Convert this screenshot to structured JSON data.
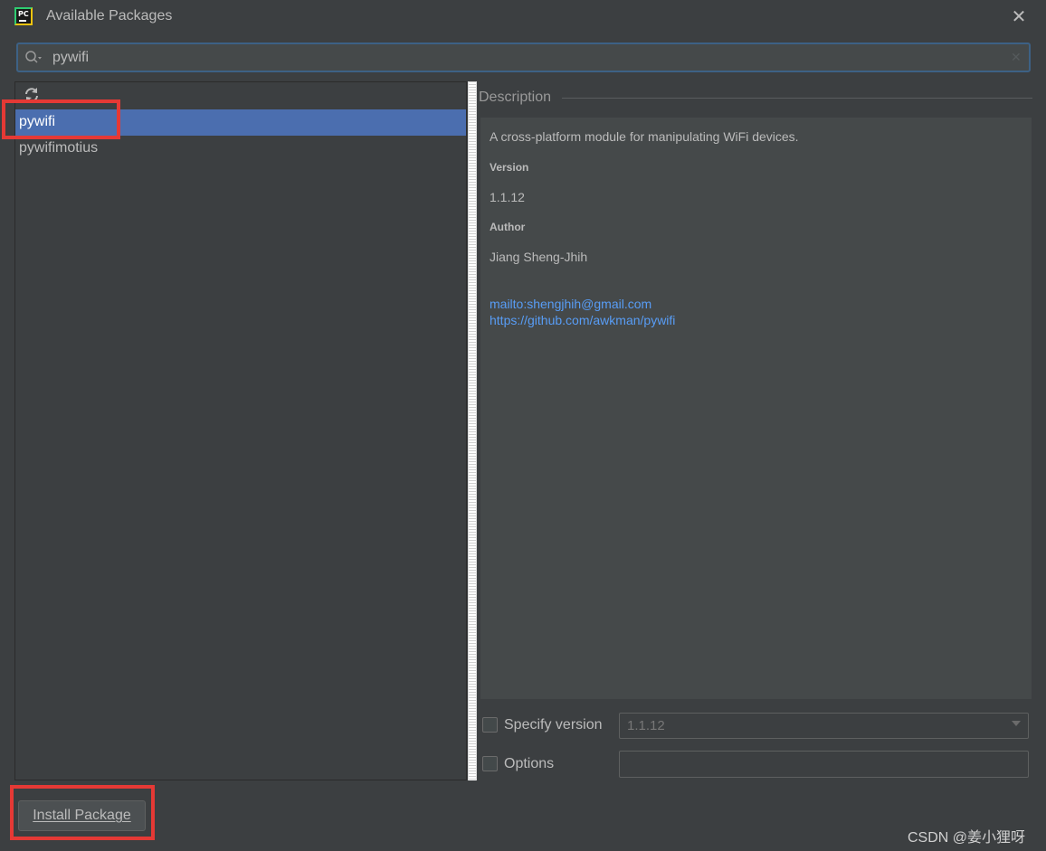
{
  "window": {
    "title": "Available Packages",
    "app_icon_text": "PC",
    "close_glyph": "✕"
  },
  "search": {
    "value": "pywifi"
  },
  "packages": [
    {
      "name": "pywifi",
      "selected": true
    },
    {
      "name": "pywifimotius",
      "selected": false
    }
  ],
  "description": {
    "header": "Description",
    "summary": "A cross-platform module for manipulating WiFi devices.",
    "version_label": "Version",
    "version": "1.1.12",
    "author_label": "Author",
    "author": "Jiang Sheng-Jhih",
    "links": [
      "mailto:shengjhih@gmail.com",
      "https://github.com/awkman/pywifi"
    ]
  },
  "specify_version": {
    "label": "Specify version",
    "checked": false,
    "value": "1.1.12"
  },
  "options": {
    "label": "Options",
    "checked": false,
    "value": ""
  },
  "install_button": {
    "label": "Install Package"
  },
  "watermark": "CSDN @姜小狸呀",
  "colors": {
    "background": "#3c3f41",
    "selection": "#4b6eaf",
    "link": "#589df6",
    "annotation": "#e53935"
  },
  "icons": {
    "search": "magnifier-icon",
    "refresh": "refresh-icon",
    "close": "close-icon"
  }
}
